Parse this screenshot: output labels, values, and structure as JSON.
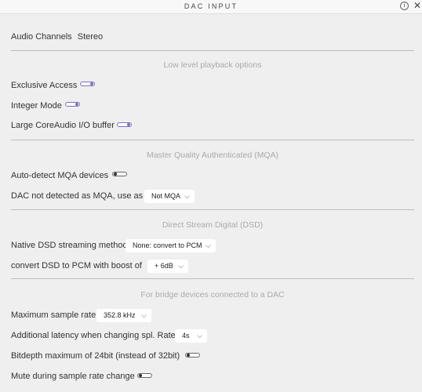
{
  "window": {
    "title": "DAC INPUT",
    "info_icon": "i",
    "close_icon": "✕"
  },
  "audio_channels": {
    "label": "Audio Channels",
    "value": "Stereo"
  },
  "sections": {
    "low_level": "Low level playback options",
    "mqa": "Master Quality Authenticated (MQA)",
    "dsd": "Direct Stream Digital (DSD)",
    "bridge": "For bridge devices connected to a DAC"
  },
  "low_level": {
    "exclusive_access": {
      "label": "Exclusive Access",
      "on": true
    },
    "integer_mode": {
      "label": "Integer Mode",
      "on": true
    },
    "large_buffer": {
      "label": "Large CoreAudio I/O buffer",
      "on": true
    }
  },
  "mqa": {
    "auto_detect": {
      "label": "Auto-detect MQA devices",
      "on": false
    },
    "not_detected": {
      "label": "DAC not detected as MQA, use as",
      "value": "Not MQA"
    }
  },
  "dsd": {
    "native_method": {
      "label": "Native DSD streaming method",
      "value": "None: convert to PCM"
    },
    "boost": {
      "label": "convert DSD to PCM with boost of",
      "value": "+ 6dB"
    }
  },
  "bridge": {
    "max_rate": {
      "label": "Maximum sample rate",
      "value": "352.8 kHz"
    },
    "latency": {
      "label": "Additional latency when changing spl. Rate",
      "value": "4s"
    },
    "bitdepth": {
      "label": "Bitdepth maximum of 24bit (instead of 32bit)",
      "on": false
    },
    "mute": {
      "label": "Mute during sample rate change",
      "on": false
    }
  },
  "icons": {
    "dropdown": "chevron-down-icon",
    "info": "info-icon",
    "close": "close-icon"
  },
  "colors": {
    "toggle_on": "#7a70c0",
    "toggle_off": "#333333",
    "section_text": "#aaaaaa",
    "background": "#efefef"
  }
}
